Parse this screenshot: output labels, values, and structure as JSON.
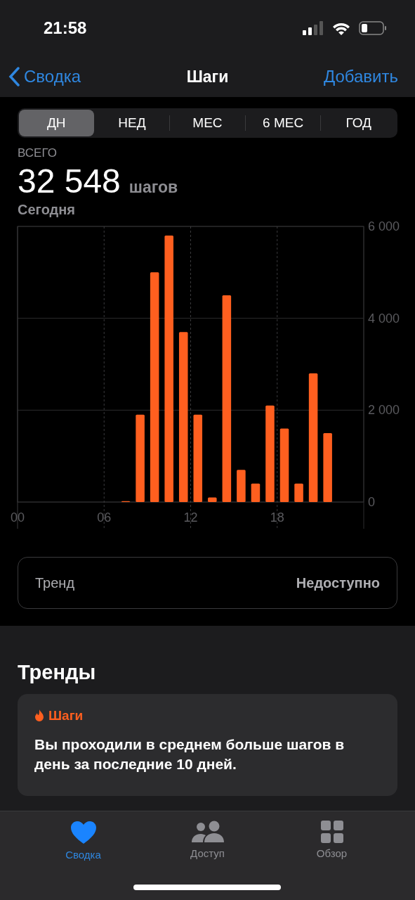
{
  "status_bar": {
    "time": "21:58"
  },
  "nav": {
    "back": "Сводка",
    "title": "Шаги",
    "action": "Добавить"
  },
  "segments": [
    {
      "label": "ДН",
      "selected": true
    },
    {
      "label": "НЕД",
      "selected": false
    },
    {
      "label": "МЕС",
      "selected": false
    },
    {
      "label": "6 МЕС",
      "selected": false
    },
    {
      "label": "ГОД",
      "selected": false
    }
  ],
  "summary": {
    "label": "ВСЕГО",
    "value": "32 548",
    "unit": "шагов",
    "date": "Сегодня"
  },
  "chart_data": {
    "type": "bar",
    "x": [
      0.5,
      1.5,
      2.5,
      3.5,
      4.5,
      5.5,
      6.5,
      7.5,
      8.5,
      9.5,
      10.5,
      11.5,
      12.5,
      13.5,
      14.5,
      15.5,
      16.5,
      17.5,
      18.5,
      19.5,
      20.5,
      21.5,
      22.5,
      23.5
    ],
    "series": [
      {
        "color": "#ff5f1f",
        "values": [
          0,
          0,
          0,
          0,
          0,
          0,
          0,
          20,
          1900,
          5000,
          5800,
          3700,
          1900,
          100,
          4500,
          700,
          400,
          2100,
          1600,
          400,
          2800,
          1500,
          0,
          0
        ]
      }
    ],
    "xlim": [
      0,
      24
    ],
    "grid": true,
    "ylim": [
      0,
      6000
    ],
    "xticks": [
      {
        "value": 0,
        "label": "00"
      },
      {
        "value": 6,
        "label": "06"
      },
      {
        "value": 12,
        "label": "12"
      },
      {
        "value": 18,
        "label": "18"
      }
    ],
    "yticks": [
      {
        "value": 0,
        "label": "0"
      },
      {
        "value": 2000,
        "label": "2 000"
      },
      {
        "value": 4000,
        "label": "4 000"
      },
      {
        "value": 6000,
        "label": "6 000"
      }
    ]
  },
  "trend": {
    "label": "Тренд",
    "value": "Недоступно"
  },
  "trends_section": {
    "title": "Тренды",
    "card": {
      "category": "Шаги",
      "text": "Вы проходили в среднем больше шагов в день за последние 10 дней."
    }
  },
  "tab_bar": [
    {
      "label": "Сводка",
      "kind": "heart",
      "selected": true
    },
    {
      "label": "Доступ",
      "kind": "people",
      "selected": false
    },
    {
      "label": "Обзор",
      "kind": "grid",
      "selected": false
    }
  ]
}
